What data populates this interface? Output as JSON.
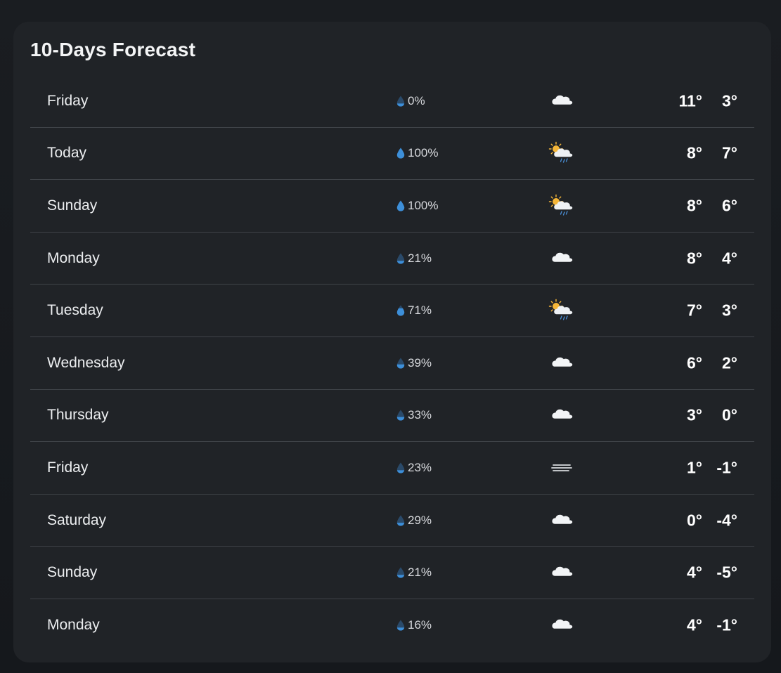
{
  "title": "10-Days Forecast",
  "colors": {
    "card_bg": "#202327",
    "divider": "#3f4348",
    "drop_blue": "#3d8fd9"
  },
  "days": [
    {
      "day": "Friday",
      "precip": "0%",
      "precip_fill": 0.0,
      "icon": "cloud-icon",
      "hi": "11°",
      "lo": "3°"
    },
    {
      "day": "Today",
      "precip": "100%",
      "precip_fill": 1.0,
      "icon": "partly-cloudy-rain-icon",
      "hi": "8°",
      "lo": "7°"
    },
    {
      "day": "Sunday",
      "precip": "100%",
      "precip_fill": 1.0,
      "icon": "partly-cloudy-rain-icon",
      "hi": "8°",
      "lo": "6°"
    },
    {
      "day": "Monday",
      "precip": "21%",
      "precip_fill": 0.21,
      "icon": "cloud-icon",
      "hi": "8°",
      "lo": "4°"
    },
    {
      "day": "Tuesday",
      "precip": "71%",
      "precip_fill": 0.71,
      "icon": "partly-cloudy-rain-icon",
      "hi": "7°",
      "lo": "3°"
    },
    {
      "day": "Wednesday",
      "precip": "39%",
      "precip_fill": 0.39,
      "icon": "cloud-icon",
      "hi": "6°",
      "lo": "2°"
    },
    {
      "day": "Thursday",
      "precip": "33%",
      "precip_fill": 0.33,
      "icon": "cloud-icon",
      "hi": "3°",
      "lo": "0°"
    },
    {
      "day": "Friday",
      "precip": "23%",
      "precip_fill": 0.23,
      "icon": "fog-icon",
      "hi": "1°",
      "lo": "-1°"
    },
    {
      "day": "Saturday",
      "precip": "29%",
      "precip_fill": 0.29,
      "icon": "cloud-icon",
      "hi": "0°",
      "lo": "-4°"
    },
    {
      "day": "Sunday",
      "precip": "21%",
      "precip_fill": 0.21,
      "icon": "cloud-icon",
      "hi": "4°",
      "lo": "-5°"
    },
    {
      "day": "Monday",
      "precip": "16%",
      "precip_fill": 0.16,
      "icon": "cloud-icon",
      "hi": "4°",
      "lo": "-1°"
    }
  ]
}
